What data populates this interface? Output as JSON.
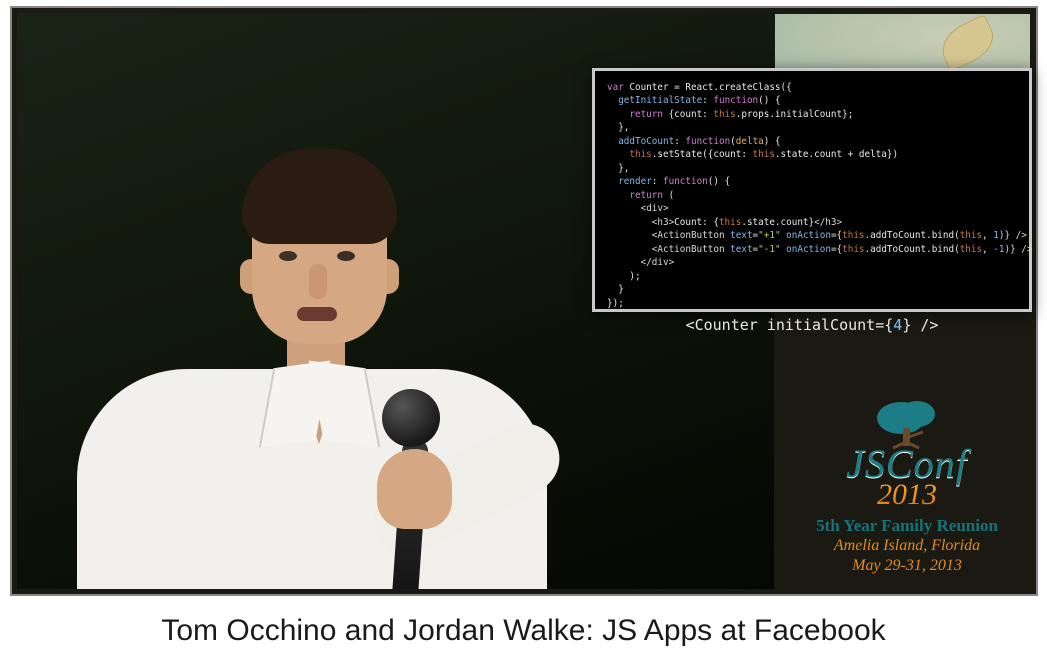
{
  "caption": "Tom Occhino and Jordan Walke: JS Apps at Facebook",
  "conference": {
    "name": "JSConf",
    "year": "2013",
    "tagline": "5th Year Family Reunion",
    "location": "Amelia Island, Florida",
    "dates": "May 29-31, 2013"
  },
  "code": {
    "lines": [
      {
        "indent": 0,
        "segments": [
          {
            "t": "var ",
            "c": "kw"
          },
          {
            "t": "Counter = React.createClass({",
            "c": ""
          }
        ]
      },
      {
        "indent": 1,
        "segments": [
          {
            "t": "getInitialState",
            "c": "fn"
          },
          {
            "t": ": ",
            "c": ""
          },
          {
            "t": "function",
            "c": "kw"
          },
          {
            "t": "() {",
            "c": ""
          }
        ]
      },
      {
        "indent": 2,
        "segments": [
          {
            "t": "return ",
            "c": "kw"
          },
          {
            "t": "{count: ",
            "c": ""
          },
          {
            "t": "this",
            "c": "this"
          },
          {
            "t": ".props.initialCount};",
            "c": ""
          }
        ]
      },
      {
        "indent": 1,
        "segments": [
          {
            "t": "},",
            "c": ""
          }
        ]
      },
      {
        "indent": 1,
        "segments": [
          {
            "t": "addToCount",
            "c": "fn"
          },
          {
            "t": ": ",
            "c": ""
          },
          {
            "t": "function",
            "c": "kw"
          },
          {
            "t": "(",
            "c": ""
          },
          {
            "t": "delta",
            "c": "param"
          },
          {
            "t": ") {",
            "c": ""
          }
        ]
      },
      {
        "indent": 2,
        "segments": [
          {
            "t": "this",
            "c": "this"
          },
          {
            "t": ".setState({count: ",
            "c": ""
          },
          {
            "t": "this",
            "c": "this"
          },
          {
            "t": ".state.count + delta})",
            "c": ""
          }
        ]
      },
      {
        "indent": 1,
        "segments": [
          {
            "t": "},",
            "c": ""
          }
        ]
      },
      {
        "indent": 1,
        "segments": [
          {
            "t": "render",
            "c": "fn"
          },
          {
            "t": ": ",
            "c": ""
          },
          {
            "t": "function",
            "c": "kw"
          },
          {
            "t": "() {",
            "c": ""
          }
        ]
      },
      {
        "indent": 2,
        "segments": [
          {
            "t": "return ",
            "c": "kw"
          },
          {
            "t": "(",
            "c": ""
          }
        ]
      },
      {
        "indent": 3,
        "segments": [
          {
            "t": "<div>",
            "c": "tag"
          }
        ]
      },
      {
        "indent": 4,
        "segments": [
          {
            "t": "<h3>",
            "c": "tag"
          },
          {
            "t": "Count: {",
            "c": ""
          },
          {
            "t": "this",
            "c": "this"
          },
          {
            "t": ".state.count}",
            "c": ""
          },
          {
            "t": "</h3>",
            "c": "tag"
          }
        ]
      },
      {
        "indent": 4,
        "segments": [
          {
            "t": "<ActionButton ",
            "c": "tag"
          },
          {
            "t": "text",
            "c": "attr"
          },
          {
            "t": "=",
            "c": ""
          },
          {
            "t": "\"+1\"",
            "c": "str"
          },
          {
            "t": " ",
            "c": ""
          },
          {
            "t": "onAction",
            "c": "attr"
          },
          {
            "t": "={",
            "c": ""
          },
          {
            "t": "this",
            "c": "this"
          },
          {
            "t": ".addToCount.bind(",
            "c": ""
          },
          {
            "t": "this",
            "c": "this"
          },
          {
            "t": ", ",
            "c": ""
          },
          {
            "t": "1",
            "c": "num"
          },
          {
            "t": ")} />",
            "c": "tag"
          }
        ]
      },
      {
        "indent": 4,
        "segments": [
          {
            "t": "<ActionButton ",
            "c": "tag"
          },
          {
            "t": "text",
            "c": "attr"
          },
          {
            "t": "=",
            "c": ""
          },
          {
            "t": "\"-1\"",
            "c": "str"
          },
          {
            "t": " ",
            "c": ""
          },
          {
            "t": "onAction",
            "c": "attr"
          },
          {
            "t": "={",
            "c": ""
          },
          {
            "t": "this",
            "c": "this"
          },
          {
            "t": ".addToCount.bind(",
            "c": ""
          },
          {
            "t": "this",
            "c": "this"
          },
          {
            "t": ", ",
            "c": ""
          },
          {
            "t": "-1",
            "c": "num"
          },
          {
            "t": ")} />",
            "c": "tag"
          }
        ]
      },
      {
        "indent": 3,
        "segments": [
          {
            "t": "</div>",
            "c": "tag"
          }
        ]
      },
      {
        "indent": 2,
        "segments": [
          {
            "t": ");",
            "c": ""
          }
        ]
      },
      {
        "indent": 1,
        "segments": [
          {
            "t": "}",
            "c": ""
          }
        ]
      },
      {
        "indent": 0,
        "segments": [
          {
            "t": "});",
            "c": ""
          }
        ]
      }
    ],
    "callout": {
      "prefix": "<Counter initialCount={",
      "value": "4",
      "suffix": "} />"
    }
  }
}
